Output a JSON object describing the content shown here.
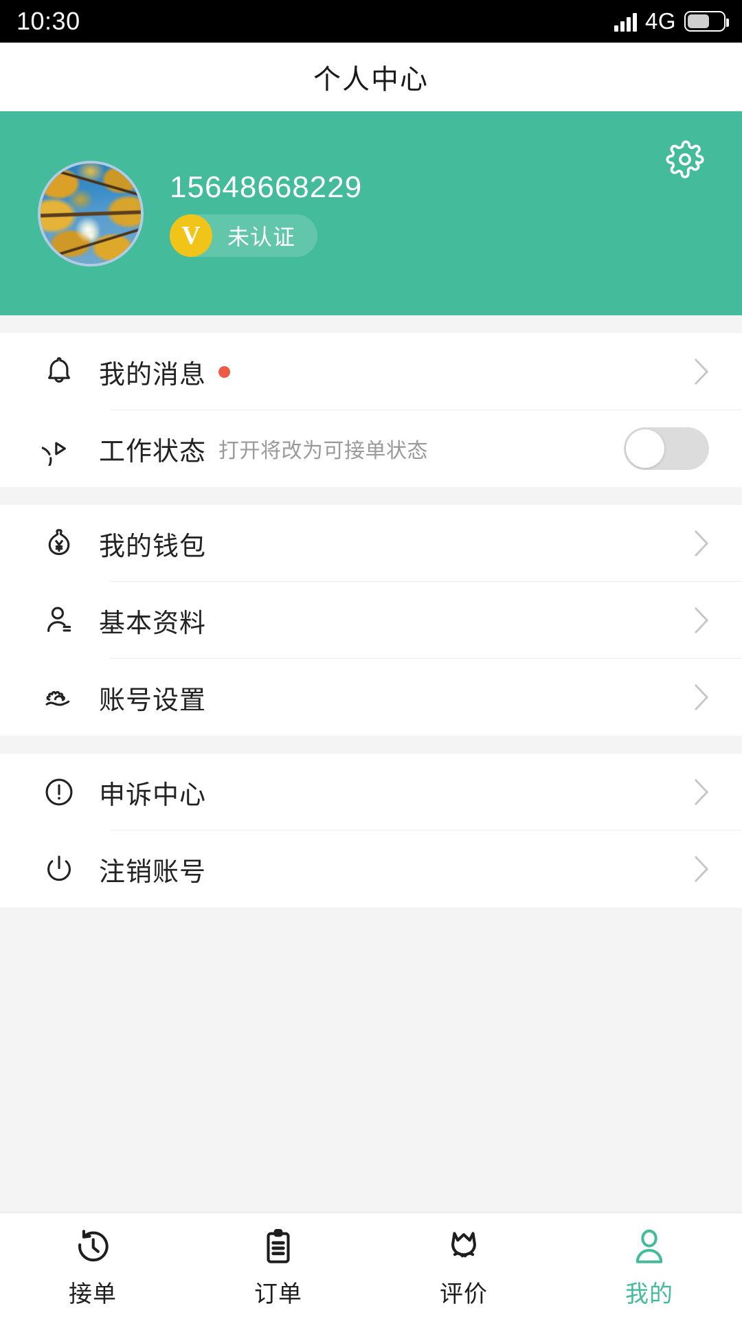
{
  "status_bar": {
    "time": "10:30",
    "network": "4G",
    "signal_icon": "signal-bars-icon",
    "battery_icon": "battery-icon"
  },
  "header": {
    "title": "个人中心"
  },
  "profile": {
    "settings_icon": "gear-icon",
    "avatar_icon": "avatar",
    "phone": "15648668229",
    "verify_badge": {
      "mark": "V",
      "label": "未认证"
    },
    "accent_color": "#44bc9b",
    "badge_color": "#f0c419"
  },
  "groups": [
    {
      "rows": [
        {
          "icon": "bell-icon",
          "label": "我的消息",
          "sub": "",
          "badge_dot": true,
          "badge_color": "#ec5b44",
          "control": "chevron"
        },
        {
          "icon": "play-circle-icon",
          "label": "工作状态",
          "sub": "打开将改为可接单状态",
          "badge_dot": false,
          "control": "toggle",
          "toggle_on": false
        }
      ]
    },
    {
      "rows": [
        {
          "icon": "money-bag-icon",
          "label": "我的钱包",
          "sub": "",
          "badge_dot": false,
          "control": "chevron"
        },
        {
          "icon": "person-info-icon",
          "label": "基本资料",
          "sub": "",
          "badge_dot": false,
          "control": "chevron"
        },
        {
          "icon": "account-settings-icon",
          "label": "账号设置",
          "sub": "",
          "badge_dot": false,
          "control": "chevron"
        }
      ]
    },
    {
      "rows": [
        {
          "icon": "exclamation-circle-icon",
          "label": "申诉中心",
          "sub": "",
          "badge_dot": false,
          "control": "chevron"
        },
        {
          "icon": "power-icon",
          "label": "注销账号",
          "sub": "",
          "badge_dot": false,
          "control": "chevron"
        }
      ]
    }
  ],
  "tabbar": {
    "active_color": "#44bc9b",
    "tabs": [
      {
        "icon": "clock-rotate-icon",
        "label": "接单",
        "active": false
      },
      {
        "icon": "clipboard-icon",
        "label": "订单",
        "active": false
      },
      {
        "icon": "flower-icon",
        "label": "评价",
        "active": false
      },
      {
        "icon": "person-icon",
        "label": "我的",
        "active": true
      }
    ]
  }
}
